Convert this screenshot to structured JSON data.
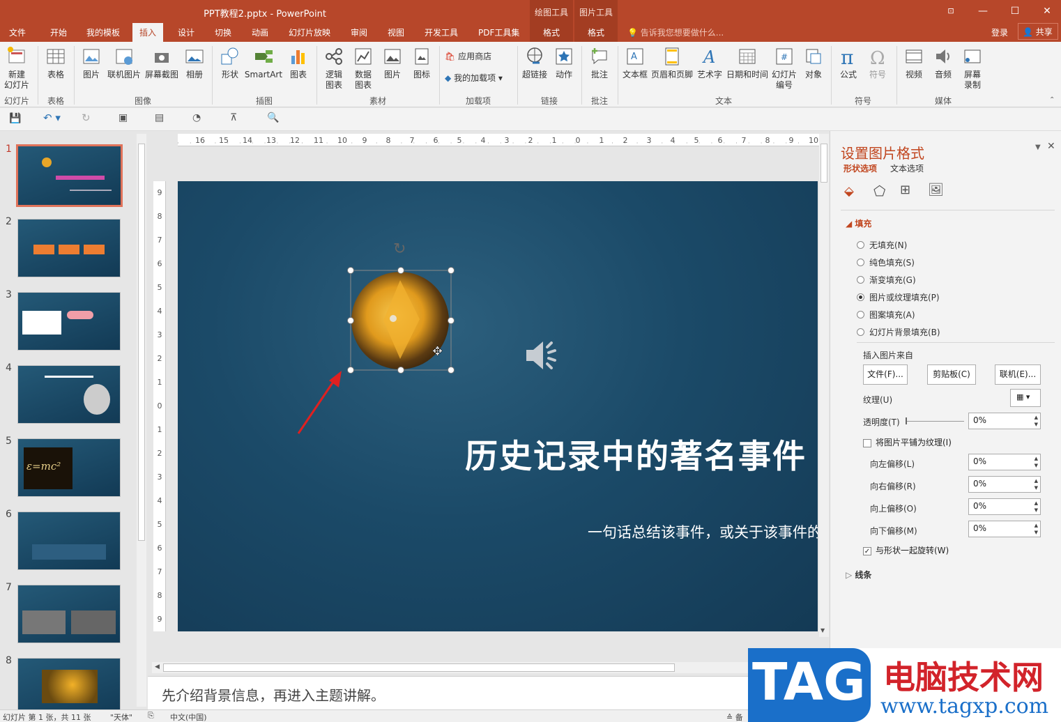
{
  "window": {
    "title": "PPT教程2.pptx - PowerPoint"
  },
  "context_tabs": [
    {
      "group": "绘图工具",
      "tab": "格式"
    },
    {
      "group": "图片工具",
      "tab": "格式"
    }
  ],
  "tabs": [
    "文件",
    "开始",
    "我的模板",
    "插入",
    "设计",
    "切换",
    "动画",
    "幻灯片放映",
    "审阅",
    "视图",
    "开发工具",
    "PDF工具集"
  ],
  "active_tab": "插入",
  "tell_me": "告诉我您想要做什么...",
  "login": "登录",
  "share": "共享",
  "ribbon": {
    "new_slide": "新建\n幻灯片",
    "table": "表格",
    "picture": "图片",
    "online_picture": "联机图片",
    "screenshot": "屏幕截图",
    "album": "相册",
    "shapes": "形状",
    "smartart": "SmartArt",
    "chart": "图表",
    "logic_chart": "逻辑\n图表",
    "data_chart": "数据\n图表",
    "picture2": "图片",
    "icons": "图标",
    "store": "应用商店",
    "my_addins": "我的加载项",
    "hyperlink": "超链接",
    "action": "动作",
    "comment": "批注",
    "textbox": "文本框",
    "header_footer": "页眉和页脚",
    "wordart": "艺术字",
    "datetime": "日期和时间",
    "slide_number": "幻灯片\n编号",
    "object": "对象",
    "equation": "公式",
    "symbol": "符号",
    "video": "视频",
    "audio": "音频",
    "screen_record": "屏幕\n录制",
    "groups": {
      "slides": "幻灯片",
      "tables": "表格",
      "images": "图像",
      "illustrations": "插图",
      "material": "素材",
      "addins": "加载项",
      "links": "链接",
      "comments": "批注",
      "text": "文本",
      "symbols": "符号",
      "media": "媒体"
    }
  },
  "thumbnails": [
    "1",
    "2",
    "3",
    "4",
    "5",
    "6",
    "7",
    "8"
  ],
  "slide": {
    "title": "历史记录中的著名事件",
    "subtitle": "一句话总结该事件，或关于该事件的"
  },
  "notes": "先介绍背景信息，再进入主题讲解。",
  "pane": {
    "title": "设置图片格式",
    "tab_shape": "形状选项",
    "tab_text": "文本选项",
    "fill_section": "填充",
    "fill_options": [
      "无填充(N)",
      "纯色填充(S)",
      "渐变填充(G)",
      "图片或纹理填充(P)",
      "图案填充(A)",
      "幻灯片背景填充(B)"
    ],
    "selected_fill_index": 3,
    "insert_from": "插入图片来自",
    "btn_file": "文件(F)...",
    "btn_clipboard": "剪贴板(C)",
    "btn_online": "联机(E)...",
    "texture": "纹理(U)",
    "transparency": "透明度(T)",
    "transparency_value": "0%",
    "tile": "将图片平铺为纹理(I)",
    "offset_left": "向左偏移(L)",
    "offset_right": "向右偏移(R)",
    "offset_top": "向上偏移(O)",
    "offset_bottom": "向下偏移(M)",
    "offset_left_value": "0%",
    "offset_right_value": "0%",
    "offset_top_value": "0%",
    "offset_bottom_value": "0%",
    "rotate_with_shape": "与形状一起旋转(W)",
    "line_section": "线条"
  },
  "status": {
    "slide_info": "幻灯片 第 1 张，共 11 张",
    "theme": "\"天体\"",
    "language": "中文(中国)",
    "notes_btn": "备"
  },
  "watermark": {
    "tag": "TAG",
    "cn": "电脑技术网",
    "url": "www.tagxp.com"
  },
  "colors": {
    "accent": "#b7472a",
    "slide_bg": "#1b4a68",
    "arrow": "#e02020"
  }
}
